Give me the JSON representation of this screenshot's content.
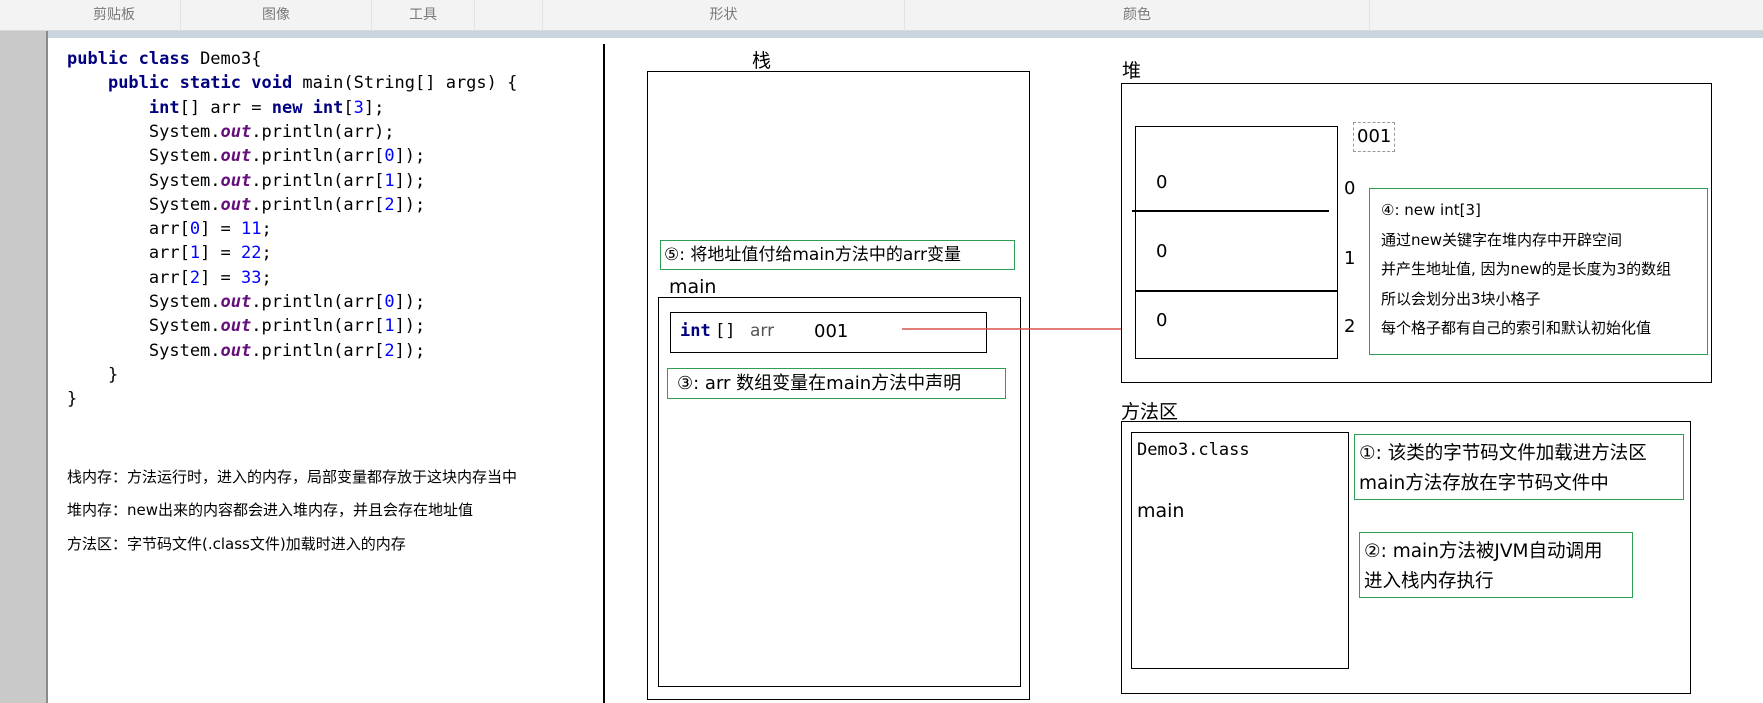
{
  "ribbon": {
    "groups": [
      "剪贴板",
      "图像",
      "工具",
      "形状",
      "颜色"
    ]
  },
  "code": {
    "lines": [
      [
        [
          "kw",
          "public class "
        ],
        [
          "t",
          "Demo3{"
        ]
      ],
      [
        [
          "t",
          "    "
        ],
        [
          "kw",
          "public static void "
        ],
        [
          "t",
          "main(String[] args) {"
        ]
      ],
      [
        [
          "t",
          "        "
        ],
        [
          "kw",
          "int"
        ],
        [
          "t",
          "[] arr = "
        ],
        [
          "kw",
          "new int"
        ],
        [
          "t",
          "["
        ],
        [
          "num",
          "3"
        ],
        [
          "t",
          "];"
        ]
      ],
      [
        [
          "t",
          "        System."
        ],
        [
          "fld",
          "out"
        ],
        [
          "t",
          ".println(arr);"
        ]
      ],
      [
        [
          "t",
          "        System."
        ],
        [
          "fld",
          "out"
        ],
        [
          "t",
          ".println(arr["
        ],
        [
          "num",
          "0"
        ],
        [
          "t",
          "]);"
        ]
      ],
      [
        [
          "t",
          "        System."
        ],
        [
          "fld",
          "out"
        ],
        [
          "t",
          ".println(arr["
        ],
        [
          "num",
          "1"
        ],
        [
          "t",
          "]);"
        ]
      ],
      [
        [
          "t",
          "        System."
        ],
        [
          "fld",
          "out"
        ],
        [
          "t",
          ".println(arr["
        ],
        [
          "num",
          "2"
        ],
        [
          "t",
          "]);"
        ]
      ],
      [
        [
          "t",
          "        arr["
        ],
        [
          "num",
          "0"
        ],
        [
          "t",
          "] = "
        ],
        [
          "num",
          "11"
        ],
        [
          "t",
          ";"
        ]
      ],
      [
        [
          "t",
          "        arr["
        ],
        [
          "num",
          "1"
        ],
        [
          "t",
          "] = "
        ],
        [
          "num",
          "22"
        ],
        [
          "t",
          ";"
        ]
      ],
      [
        [
          "t",
          "        arr["
        ],
        [
          "num",
          "2"
        ],
        [
          "t",
          "] = "
        ],
        [
          "num",
          "33"
        ],
        [
          "t",
          ";"
        ]
      ],
      [
        [
          "t",
          "        System."
        ],
        [
          "fld",
          "out"
        ],
        [
          "t",
          ".println(arr["
        ],
        [
          "num",
          "0"
        ],
        [
          "t",
          "]);"
        ]
      ],
      [
        [
          "t",
          "        System."
        ],
        [
          "fld",
          "out"
        ],
        [
          "t",
          ".println(arr["
        ],
        [
          "num",
          "1"
        ],
        [
          "t",
          "]);"
        ]
      ],
      [
        [
          "t",
          "        System."
        ],
        [
          "fld",
          "out"
        ],
        [
          "t",
          ".println(arr["
        ],
        [
          "num",
          "2"
        ],
        [
          "t",
          "]);"
        ]
      ],
      [
        [
          "t",
          "    }"
        ]
      ],
      [
        [
          "t",
          "}"
        ]
      ]
    ]
  },
  "notes": {
    "stack": "栈内存：方法运行时，进入的内存，局部变量都存放于这块内存当中",
    "heap": "堆内存：new出来的内容都会进入堆内存，并且会存在地址值",
    "method_area": "方法区：字节码文件(.class文件)加载时进入的内存"
  },
  "stack": {
    "title": "栈",
    "note5": "⑤: 将地址值付给main方法中的arr变量",
    "frame_label": "main",
    "var_type": "int",
    "var_brackets": "[]",
    "var_name": "arr",
    "var_value": "001",
    "note3": "③: arr 数组变量在main方法中声明"
  },
  "heap": {
    "title": "堆",
    "address": "001",
    "cells": [
      "0",
      "0",
      "0"
    ],
    "indices": [
      "0",
      "1",
      "2"
    ],
    "note4": [
      "④: new int[3]",
      "通过new关键字在堆内存中开辟空间",
      "并产生地址值, 因为new的是长度为3的数组",
      "所以会划分出3块小格子",
      "每个格子都有自己的索引和默认初始化值"
    ]
  },
  "method_area": {
    "title": "方法区",
    "class_name": "Demo3.class",
    "method": "main",
    "note1": [
      "①: 该类的字节码文件加载进方法区",
      "main方法存放在字节码文件中"
    ],
    "note2": [
      "②: main方法被JVM自动调用",
      "进入栈内存执行"
    ]
  },
  "colors": {
    "green_border": "#2e9e55",
    "arrow": "#d9534f",
    "keyword": "#000080",
    "field": "#660e7a",
    "number": "#0000ff"
  }
}
